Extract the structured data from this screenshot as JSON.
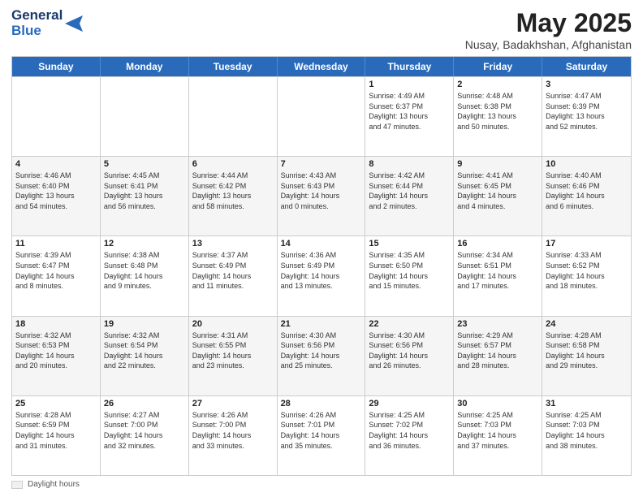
{
  "header": {
    "logo_line1": "General",
    "logo_line2": "Blue",
    "main_title": "May 2025",
    "subtitle": "Nusay, Badakhshan, Afghanistan"
  },
  "calendar": {
    "days_of_week": [
      "Sunday",
      "Monday",
      "Tuesday",
      "Wednesday",
      "Thursday",
      "Friday",
      "Saturday"
    ],
    "rows": [
      [
        {
          "day": "",
          "info": ""
        },
        {
          "day": "",
          "info": ""
        },
        {
          "day": "",
          "info": ""
        },
        {
          "day": "",
          "info": ""
        },
        {
          "day": "1",
          "info": "Sunrise: 4:49 AM\nSunset: 6:37 PM\nDaylight: 13 hours\nand 47 minutes."
        },
        {
          "day": "2",
          "info": "Sunrise: 4:48 AM\nSunset: 6:38 PM\nDaylight: 13 hours\nand 50 minutes."
        },
        {
          "day": "3",
          "info": "Sunrise: 4:47 AM\nSunset: 6:39 PM\nDaylight: 13 hours\nand 52 minutes."
        }
      ],
      [
        {
          "day": "4",
          "info": "Sunrise: 4:46 AM\nSunset: 6:40 PM\nDaylight: 13 hours\nand 54 minutes."
        },
        {
          "day": "5",
          "info": "Sunrise: 4:45 AM\nSunset: 6:41 PM\nDaylight: 13 hours\nand 56 minutes."
        },
        {
          "day": "6",
          "info": "Sunrise: 4:44 AM\nSunset: 6:42 PM\nDaylight: 13 hours\nand 58 minutes."
        },
        {
          "day": "7",
          "info": "Sunrise: 4:43 AM\nSunset: 6:43 PM\nDaylight: 14 hours\nand 0 minutes."
        },
        {
          "day": "8",
          "info": "Sunrise: 4:42 AM\nSunset: 6:44 PM\nDaylight: 14 hours\nand 2 minutes."
        },
        {
          "day": "9",
          "info": "Sunrise: 4:41 AM\nSunset: 6:45 PM\nDaylight: 14 hours\nand 4 minutes."
        },
        {
          "day": "10",
          "info": "Sunrise: 4:40 AM\nSunset: 6:46 PM\nDaylight: 14 hours\nand 6 minutes."
        }
      ],
      [
        {
          "day": "11",
          "info": "Sunrise: 4:39 AM\nSunset: 6:47 PM\nDaylight: 14 hours\nand 8 minutes."
        },
        {
          "day": "12",
          "info": "Sunrise: 4:38 AM\nSunset: 6:48 PM\nDaylight: 14 hours\nand 9 minutes."
        },
        {
          "day": "13",
          "info": "Sunrise: 4:37 AM\nSunset: 6:49 PM\nDaylight: 14 hours\nand 11 minutes."
        },
        {
          "day": "14",
          "info": "Sunrise: 4:36 AM\nSunset: 6:49 PM\nDaylight: 14 hours\nand 13 minutes."
        },
        {
          "day": "15",
          "info": "Sunrise: 4:35 AM\nSunset: 6:50 PM\nDaylight: 14 hours\nand 15 minutes."
        },
        {
          "day": "16",
          "info": "Sunrise: 4:34 AM\nSunset: 6:51 PM\nDaylight: 14 hours\nand 17 minutes."
        },
        {
          "day": "17",
          "info": "Sunrise: 4:33 AM\nSunset: 6:52 PM\nDaylight: 14 hours\nand 18 minutes."
        }
      ],
      [
        {
          "day": "18",
          "info": "Sunrise: 4:32 AM\nSunset: 6:53 PM\nDaylight: 14 hours\nand 20 minutes."
        },
        {
          "day": "19",
          "info": "Sunrise: 4:32 AM\nSunset: 6:54 PM\nDaylight: 14 hours\nand 22 minutes."
        },
        {
          "day": "20",
          "info": "Sunrise: 4:31 AM\nSunset: 6:55 PM\nDaylight: 14 hours\nand 23 minutes."
        },
        {
          "day": "21",
          "info": "Sunrise: 4:30 AM\nSunset: 6:56 PM\nDaylight: 14 hours\nand 25 minutes."
        },
        {
          "day": "22",
          "info": "Sunrise: 4:30 AM\nSunset: 6:56 PM\nDaylight: 14 hours\nand 26 minutes."
        },
        {
          "day": "23",
          "info": "Sunrise: 4:29 AM\nSunset: 6:57 PM\nDaylight: 14 hours\nand 28 minutes."
        },
        {
          "day": "24",
          "info": "Sunrise: 4:28 AM\nSunset: 6:58 PM\nDaylight: 14 hours\nand 29 minutes."
        }
      ],
      [
        {
          "day": "25",
          "info": "Sunrise: 4:28 AM\nSunset: 6:59 PM\nDaylight: 14 hours\nand 31 minutes."
        },
        {
          "day": "26",
          "info": "Sunrise: 4:27 AM\nSunset: 7:00 PM\nDaylight: 14 hours\nand 32 minutes."
        },
        {
          "day": "27",
          "info": "Sunrise: 4:26 AM\nSunset: 7:00 PM\nDaylight: 14 hours\nand 33 minutes."
        },
        {
          "day": "28",
          "info": "Sunrise: 4:26 AM\nSunset: 7:01 PM\nDaylight: 14 hours\nand 35 minutes."
        },
        {
          "day": "29",
          "info": "Sunrise: 4:25 AM\nSunset: 7:02 PM\nDaylight: 14 hours\nand 36 minutes."
        },
        {
          "day": "30",
          "info": "Sunrise: 4:25 AM\nSunset: 7:03 PM\nDaylight: 14 hours\nand 37 minutes."
        },
        {
          "day": "31",
          "info": "Sunrise: 4:25 AM\nSunset: 7:03 PM\nDaylight: 14 hours\nand 38 minutes."
        }
      ]
    ]
  },
  "footer": {
    "daylight_hours_label": "Daylight hours"
  }
}
